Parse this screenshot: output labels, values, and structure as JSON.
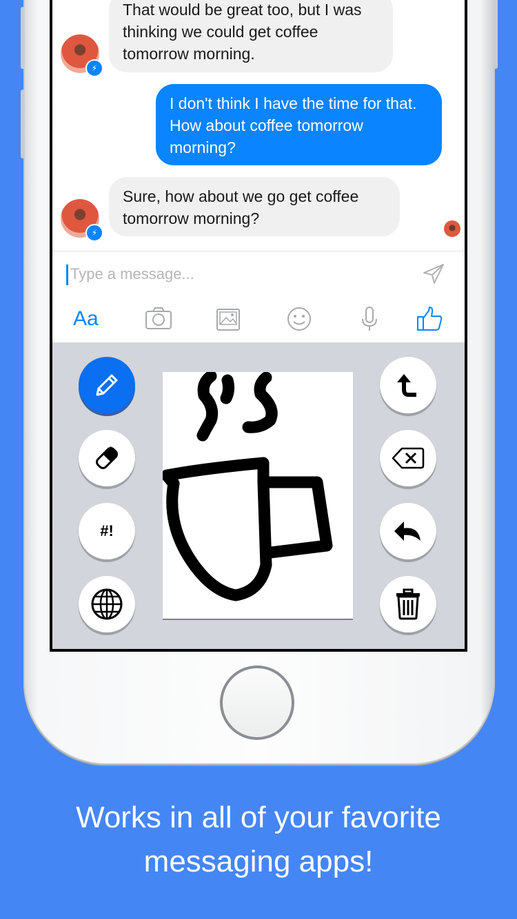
{
  "messages": [
    {
      "from": "them",
      "text": "That would be great too, but I was thinking we could get coffee tomorrow morning."
    },
    {
      "from": "me",
      "text": "I don't think I have the time for that. How about coffee tomorrow morning?"
    },
    {
      "from": "them",
      "text": "Sure, how about we go get coffee tomorrow morning?"
    }
  ],
  "compose": {
    "placeholder": "Type a message...",
    "toolbar": [
      "Aa",
      "camera-icon",
      "gallery-icon",
      "emoji-icon",
      "microphone-icon",
      "thumbs-up-icon"
    ]
  },
  "keyboard": {
    "left_tools": [
      "pencil-icon",
      "eraser-icon",
      "#!",
      "globe-icon"
    ],
    "right_tools": [
      "return-icon",
      "backspace-icon",
      "undo-icon",
      "trash-icon"
    ]
  },
  "colors": {
    "background": "#4586f5",
    "accent": "#0a84ff"
  },
  "caption": "Works in all of your favorite messaging apps!"
}
